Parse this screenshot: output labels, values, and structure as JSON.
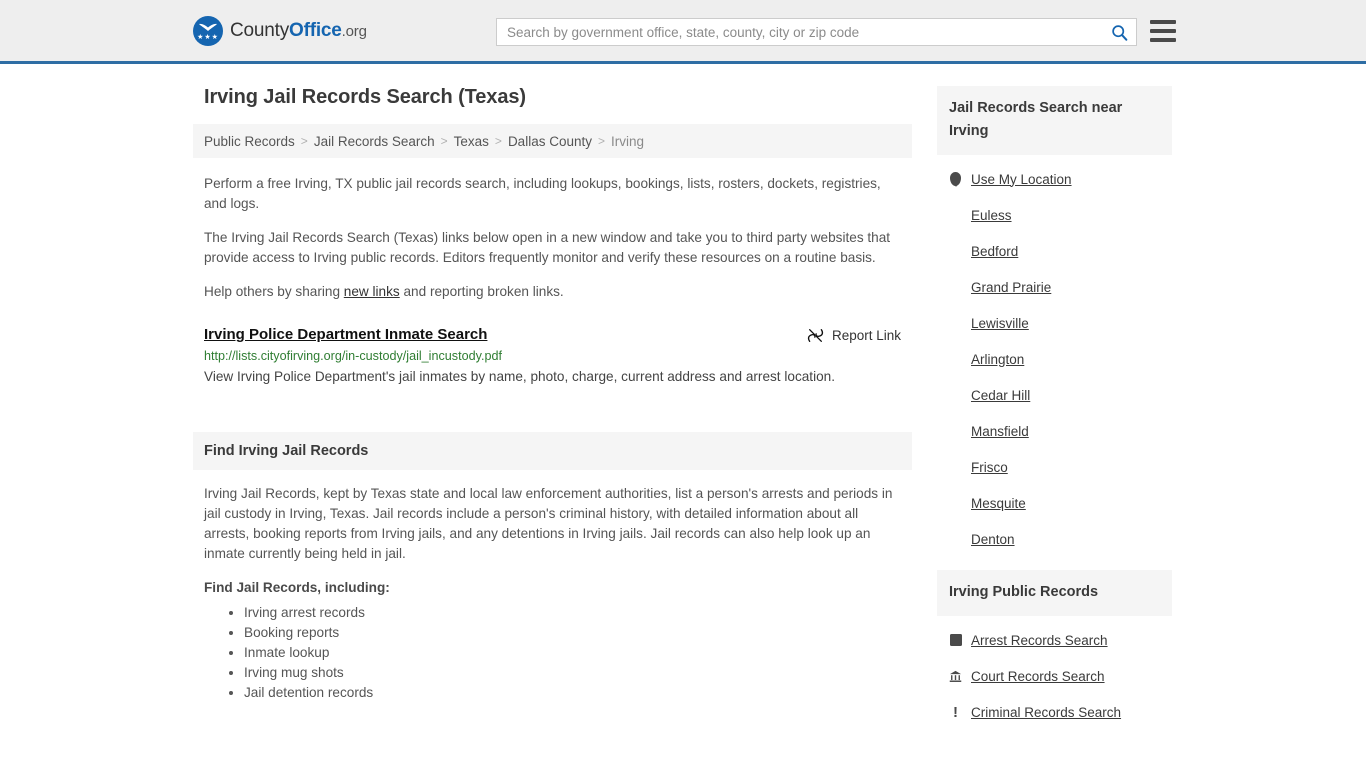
{
  "header": {
    "logo": {
      "text_part1": "County",
      "text_part2": "Office",
      "text_tld": ".org",
      "stars": "★★★"
    },
    "search": {
      "placeholder": "Search by government office, state, county, city or zip code",
      "value": ""
    }
  },
  "main": {
    "title": "Irving Jail Records Search (Texas)",
    "breadcrumb": [
      {
        "label": "Public Records",
        "current": false
      },
      {
        "label": "Jail Records Search",
        "current": false
      },
      {
        "label": "Texas",
        "current": false
      },
      {
        "label": "Dallas County",
        "current": false
      },
      {
        "label": "Irving",
        "current": true
      }
    ],
    "breadcrumb_separator": ">",
    "intro": {
      "p1": "Perform a free Irving, TX public jail records search, including lookups, bookings, lists, rosters, dockets, registries, and logs.",
      "p2": "The Irving Jail Records Search (Texas) links below open in a new window and take you to third party websites that provide access to Irving public records. Editors frequently monitor and verify these resources on a routine basis.",
      "p3_before": "Help others by sharing ",
      "p3_link": "new links",
      "p3_after": " and reporting broken links."
    },
    "result": {
      "title": "Irving Police Department Inmate Search",
      "report_label": "Report Link",
      "url": "http://lists.cityofirving.org/in-custody/jail_incustody.pdf",
      "description": "View Irving Police Department's jail inmates by name, photo, charge, current address and arrest location."
    },
    "section": {
      "header": "Find Irving Jail Records",
      "paragraph": "Irving Jail Records, kept by Texas state and local law enforcement authorities, list a person's arrests and periods in jail custody in Irving, Texas. Jail records include a person's criminal history, with detailed information about all arrests, booking reports from Irving jails, and any detentions in Irving jails. Jail records can also help look up an inmate currently being held in jail.",
      "subhead": "Find Jail Records, including:",
      "bullets": [
        "Irving arrest records",
        "Booking reports",
        "Inmate lookup",
        "Irving mug shots",
        "Jail detention records"
      ]
    }
  },
  "sidebar": {
    "nearby": {
      "header": "Jail Records Search near Irving",
      "use_my_location": "Use My Location",
      "cities": [
        "Euless",
        "Bedford",
        "Grand Prairie",
        "Lewisville",
        "Arlington",
        "Cedar Hill",
        "Mansfield",
        "Frisco",
        "Mesquite",
        "Denton"
      ]
    },
    "public_records": {
      "header": "Irving Public Records",
      "items": [
        {
          "label": "Arrest Records Search",
          "icon": "fingerprint-square-icon"
        },
        {
          "label": "Court Records Search",
          "icon": "courthouse-icon"
        },
        {
          "label": "Criminal Records Search",
          "icon": "exclamation-icon"
        }
      ]
    }
  },
  "colors": {
    "brand_blue": "#1565b0",
    "header_border": "#2e6da4",
    "url_green": "#2f7d32",
    "panel_bg": "#f5f5f5",
    "header_bg": "#eeeeee"
  }
}
